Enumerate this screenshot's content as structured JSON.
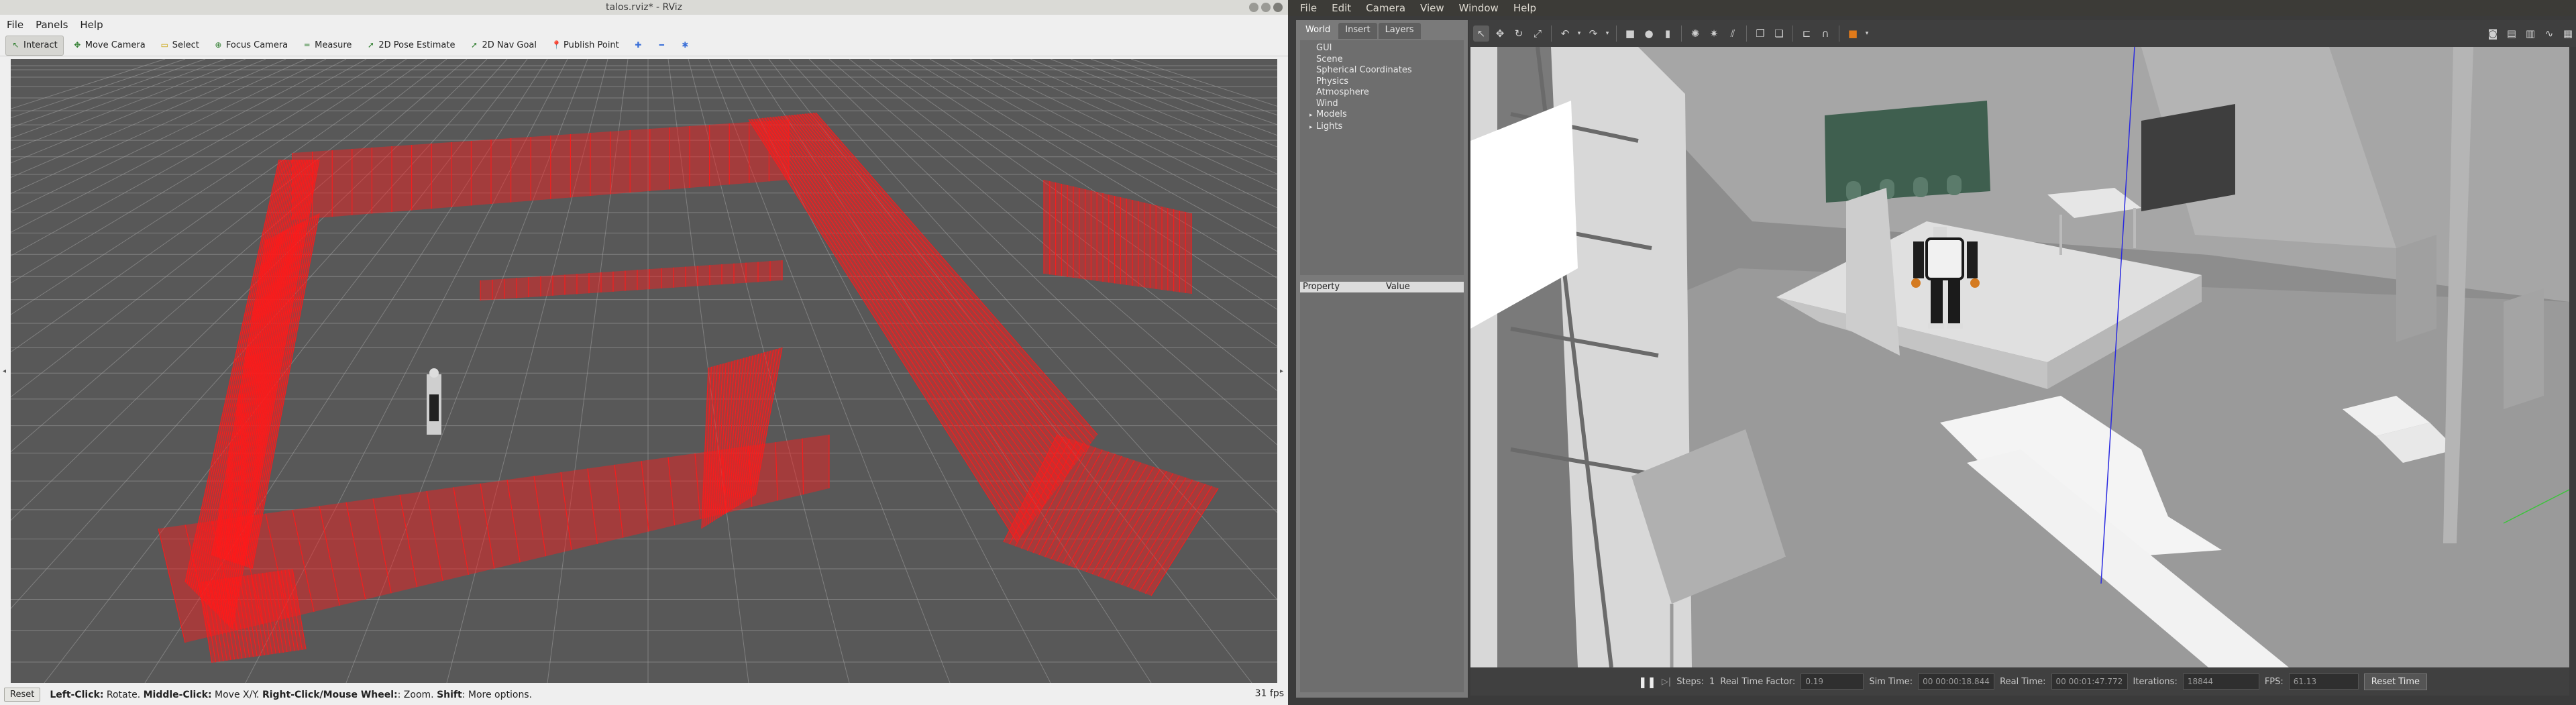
{
  "rviz": {
    "title": "talos.rviz* - RViz",
    "menu": [
      "File",
      "Panels",
      "Help"
    ],
    "tools": [
      {
        "label": "Interact",
        "icon": "cursor-icon",
        "glyph": "↖",
        "active": true
      },
      {
        "label": "Move Camera",
        "icon": "move-camera-icon",
        "glyph": "✥",
        "active": false
      },
      {
        "label": "Select",
        "icon": "select-icon",
        "glyph": "▭",
        "active": false
      },
      {
        "label": "Focus Camera",
        "icon": "focus-camera-icon",
        "glyph": "⊕",
        "active": false
      },
      {
        "label": "Measure",
        "icon": "measure-icon",
        "glyph": "═",
        "active": false
      },
      {
        "label": "2D Pose Estimate",
        "icon": "pose-estimate-icon",
        "glyph": "➚",
        "active": false
      },
      {
        "label": "2D Nav Goal",
        "icon": "nav-goal-icon",
        "glyph": "➚",
        "active": false
      },
      {
        "label": "Publish Point",
        "icon": "publish-point-icon",
        "glyph": "📍",
        "active": false
      }
    ],
    "status": {
      "reset": "Reset",
      "hint_parts": [
        {
          "b": "Left-Click:",
          "t": " Rotate. "
        },
        {
          "b": "Middle-Click:",
          "t": " Move X/Y. "
        },
        {
          "b": "Right-Click/Mouse Wheel:",
          "t": ": Zoom. "
        },
        {
          "b": "Shift",
          "t": ": More options."
        }
      ],
      "fps": "31 fps"
    },
    "colors": {
      "points": "#ff1a1a",
      "grid": "#a0a0a0",
      "background": "#585858"
    }
  },
  "gazebo": {
    "menu": [
      "File",
      "Edit",
      "Camera",
      "View",
      "Window",
      "Help"
    ],
    "tabs": [
      "World",
      "Insert",
      "Layers"
    ],
    "tree": [
      {
        "label": "GUI",
        "expandable": false
      },
      {
        "label": "Scene",
        "expandable": false
      },
      {
        "label": "Spherical Coordinates",
        "expandable": false
      },
      {
        "label": "Physics",
        "expandable": false
      },
      {
        "label": "Atmosphere",
        "expandable": false
      },
      {
        "label": "Wind",
        "expandable": false
      },
      {
        "label": "Models",
        "expandable": true
      },
      {
        "label": "Lights",
        "expandable": true
      }
    ],
    "props": {
      "col1": "Property",
      "col2": "Value"
    },
    "bottom": {
      "steps_label": "Steps:",
      "steps_value": "1",
      "rtf_label": "Real Time Factor:",
      "rtf_value": "0.19",
      "sim_label": "Sim Time:",
      "sim_value": "00 00:00:18.844",
      "real_label": "Real Time:",
      "real_value": "00 00:01:47.772",
      "iter_label": "Iterations:",
      "iter_value": "18844",
      "fps_label": "FPS:",
      "fps_value": "61.13",
      "reset": "Reset Time"
    }
  }
}
